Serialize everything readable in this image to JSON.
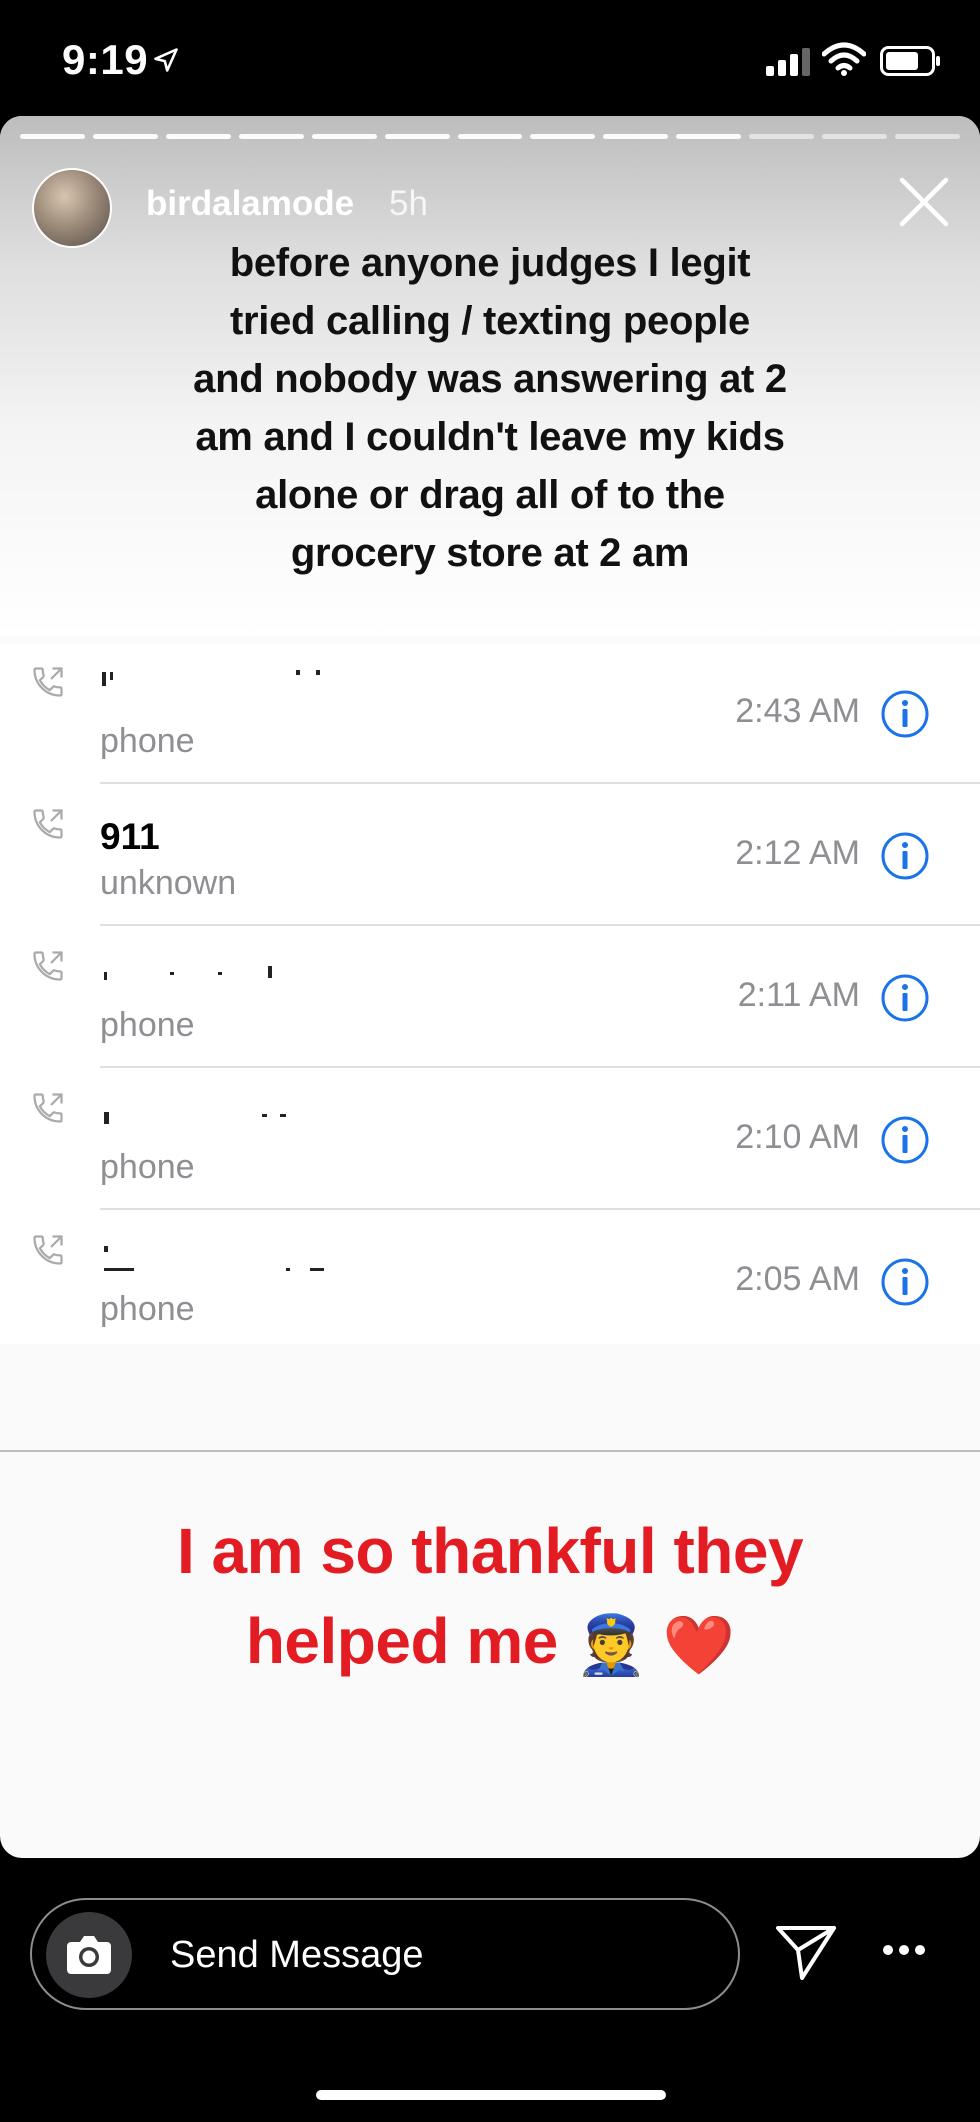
{
  "status_bar": {
    "time": "9:19",
    "icons": [
      "location-arrow-icon",
      "signal-bars-icon",
      "wifi-icon",
      "battery-icon"
    ]
  },
  "story": {
    "progress": {
      "segments": 13,
      "completed": 10
    },
    "username": "birdalamode",
    "time_ago": "5h",
    "caption": "before anyone judges I legit tried calling / texting people and nobody was answering at 2 am and I couldn't leave my kids alone or drag all of to the grocery store at 2 am",
    "thank_you": "I am so thankful they helped me",
    "thank_you_emojis": "👮 ❤️",
    "accent_color": "#e31c23"
  },
  "calls": [
    {
      "name": "",
      "type": "phone",
      "time": "2:43 AM"
    },
    {
      "name": "911",
      "type": "unknown",
      "time": "2:12 AM"
    },
    {
      "name": "",
      "type": "phone",
      "time": "2:11 AM"
    },
    {
      "name": "",
      "type": "phone",
      "time": "2:10 AM"
    },
    {
      "name": "",
      "type": "phone",
      "time": "2:05 AM"
    }
  ],
  "message_bar": {
    "placeholder": "Send Message"
  },
  "colors": {
    "info_blue": "#1a73e8",
    "secondary_text": "#8e8e93"
  }
}
